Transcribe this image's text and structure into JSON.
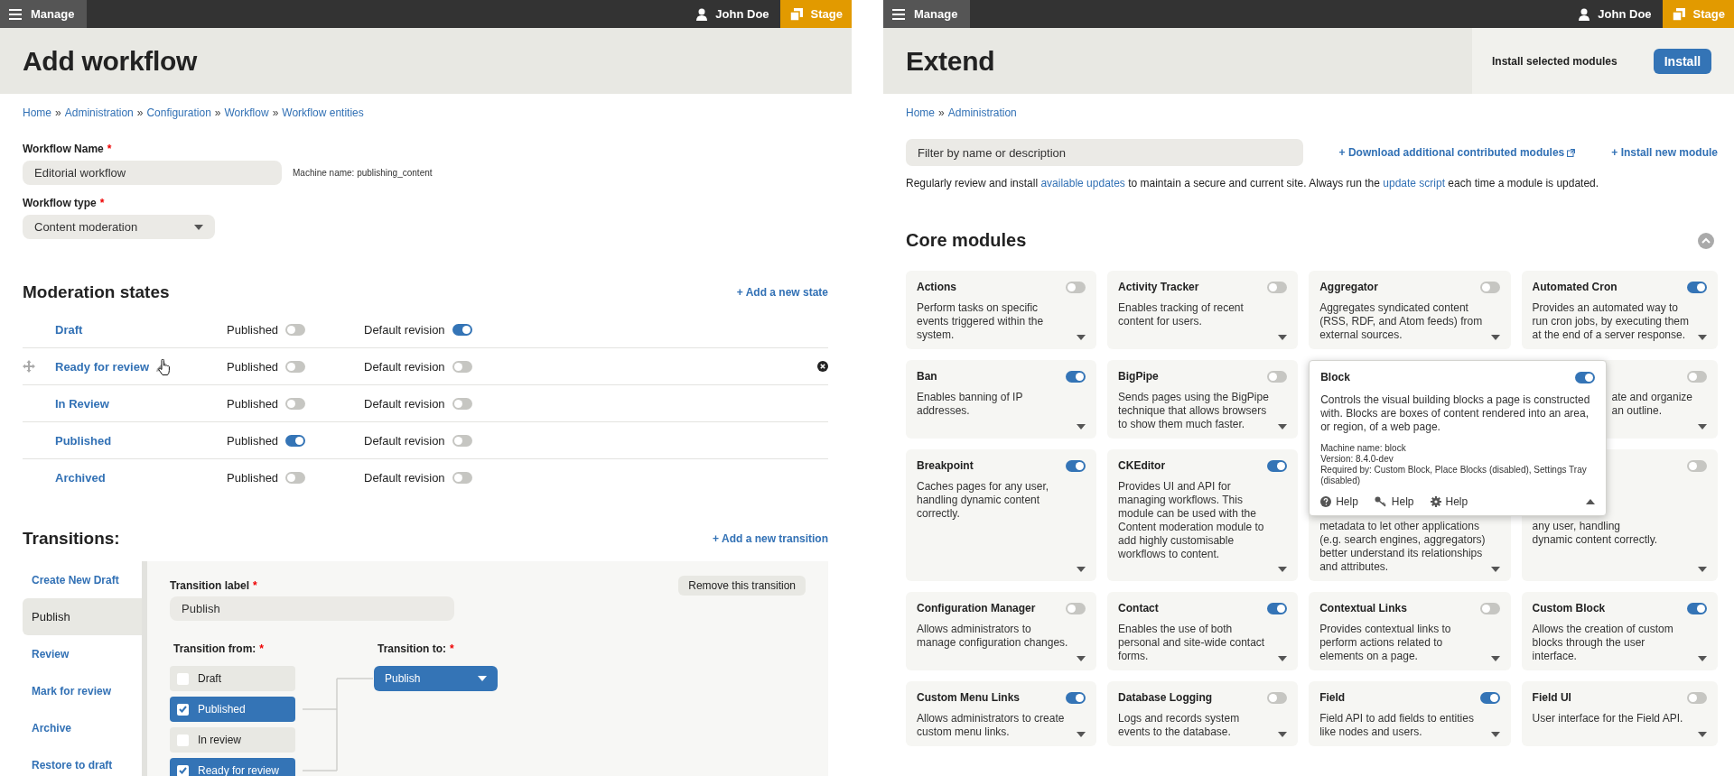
{
  "left": {
    "toolbar": {
      "menu": "Manage",
      "user": "John Doe",
      "stage": "Stage"
    },
    "title": "Add workflow",
    "breadcrumb": [
      "Home",
      "Administration",
      "Configuration",
      "Workflow",
      "Workflow entities"
    ],
    "breadcrumb_separator": "»",
    "workflow_name": {
      "label": "Workflow Name",
      "required_mark": "*",
      "value": "Editorial workflow",
      "machine_name": "Machine name: publishing_content"
    },
    "workflow_type": {
      "label": "Workflow type",
      "required_mark": "*",
      "value": "Content moderation"
    },
    "states": {
      "title": "Moderation states",
      "add_link": "+ Add a new state",
      "rows": [
        {
          "name": "Draft",
          "published_label": "Published",
          "published": false,
          "default_label": "Default revision",
          "default_revision": true,
          "hovered": false
        },
        {
          "name": "Ready for review",
          "published_label": "Published",
          "published": false,
          "default_label": "Default revision",
          "default_revision": false,
          "hovered": true
        },
        {
          "name": "In Review",
          "published_label": "Published",
          "published": false,
          "default_label": "Default revision",
          "default_revision": false,
          "hovered": false
        },
        {
          "name": "Published",
          "published_label": "Published",
          "published": true,
          "default_label": "Default revision",
          "default_revision": false,
          "hovered": false
        },
        {
          "name": "Archived",
          "published_label": "Published",
          "published": false,
          "default_label": "Default revision",
          "default_revision": false,
          "hovered": false
        }
      ]
    },
    "transitions": {
      "title": "Transitions:",
      "add_link": "+ Add a new transition",
      "tabs": [
        {
          "label": "Create New Draft",
          "selected": false
        },
        {
          "label": "Publish",
          "selected": true
        },
        {
          "label": "Review",
          "selected": false
        },
        {
          "label": "Mark for review",
          "selected": false
        },
        {
          "label": "Archive",
          "selected": false
        },
        {
          "label": "Restore to draft",
          "selected": false
        }
      ],
      "form": {
        "label_title": "Transition label",
        "required_mark": "*",
        "label_value": "Publish",
        "remove_button": "Remove this transition",
        "from_title": "Transition from:",
        "to_title": "Transition to:",
        "to_value": "Publish",
        "from_options": [
          {
            "label": "Draft",
            "checked": false
          },
          {
            "label": "Published",
            "checked": true
          },
          {
            "label": "In review",
            "checked": false
          },
          {
            "label": "Ready for review",
            "checked": true
          }
        ]
      }
    }
  },
  "right": {
    "toolbar": {
      "menu": "Manage",
      "user": "John Doe",
      "stage": "Stage"
    },
    "title": "Extend",
    "install_label": "Install selected modules",
    "install_button": "Install",
    "breadcrumb": [
      "Home",
      "Administration"
    ],
    "breadcrumb_separator": "»",
    "filter_placeholder": "Filter by name or description",
    "links": [
      {
        "label": "+ Download additional contributed modules",
        "external": true
      },
      {
        "label": "+ Install new module",
        "external": false
      }
    ],
    "notice": [
      {
        "text": "Regularly review and install "
      },
      {
        "text": "available updates",
        "kind": "link"
      },
      {
        "text": " to maintain a secure and current site. Always run the "
      },
      {
        "text": "update script",
        "kind": "link"
      },
      {
        "text": " each time a module is updated."
      }
    ],
    "modules": {
      "title": "Core modules",
      "cards": [
        {
          "kind": "card",
          "name": "Actions",
          "enabled": false,
          "description": "Perform tasks on specific events triggered within the system."
        },
        {
          "kind": "card",
          "name": "Activity Tracker",
          "enabled": false,
          "description": "Enables tracking of recent content for users."
        },
        {
          "kind": "card",
          "name": "Aggregator",
          "enabled": false,
          "description": "Aggregates syndicated content (RSS, RDF, and Atom feeds) from external sources."
        },
        {
          "kind": "card",
          "name": "Automated Cron",
          "enabled": true,
          "description": "Provides an automated way to run cron jobs, by executing them at the end of a server response."
        },
        {
          "kind": "card",
          "name": "Ban",
          "enabled": true,
          "description": "Enables banning of IP addresses."
        },
        {
          "kind": "card",
          "name": "BigPipe",
          "enabled": false,
          "description": "Sends pages using the BigPipe technique that allows browsers to show them much faster."
        },
        {
          "kind": "expanded",
          "name": "Block",
          "enabled": true,
          "description": "Controls the visual building blocks a page is constructed with. Blocks are boxes of content rendered into an area, or region, of a web page.",
          "details": [
            "Machine name: block",
            "Version: 8.4.0-dev",
            "Required by: Custom Block, Place Blocks (disabled), Settings Tray (disabled)"
          ],
          "help_links": [
            {
              "kind": "help",
              "label": "Help"
            },
            {
              "kind": "permissions",
              "label": "Help"
            },
            {
              "kind": "configure",
              "label": "Help"
            }
          ]
        },
        {
          "kind": "sidecut",
          "enabled": false,
          "lines": [
            "ate and organize",
            "an outline."
          ]
        },
        {
          "kind": "card",
          "name": "Breakpoint",
          "enabled": true,
          "description": "Caches pages for any user, handling dynamic content correctly."
        },
        {
          "kind": "card",
          "name": "CKEditor",
          "enabled": true,
          "description": "Provides UI and API for managing workflows. This module can be used with the Content moderation module to add highly customisable workflows to content."
        },
        {
          "kind": "topcut",
          "lines": [
            "metadata to let other applications",
            "(e.g. search engines, aggregators)",
            "better understand its relationships",
            "and attributes."
          ]
        },
        {
          "kind": "topcut",
          "enabled": false,
          "lines": [
            "any user, handling",
            "dynamic content correctly."
          ]
        },
        {
          "kind": "card",
          "name": "Configuration Manager",
          "enabled": false,
          "description": "Allows administrators to manage configuration changes."
        },
        {
          "kind": "card",
          "name": "Contact",
          "enabled": true,
          "description": "Enables the use of both personal and site-wide contact forms."
        },
        {
          "kind": "card",
          "name": "Contextual Links",
          "enabled": false,
          "description": "Provides contextual links to perform actions related to elements on a page."
        },
        {
          "kind": "card",
          "name": "Custom Block",
          "enabled": true,
          "description": "Allows the creation of custom blocks through the user interface."
        },
        {
          "kind": "card",
          "name": "Custom Menu Links",
          "enabled": true,
          "description": "Allows administrators to create custom menu links."
        },
        {
          "kind": "card",
          "name": "Database Logging",
          "enabled": false,
          "description": "Logs and records system events to the database."
        },
        {
          "kind": "card",
          "name": "Field",
          "enabled": true,
          "description": "Field API to add fields to entities like nodes and users."
        },
        {
          "kind": "card",
          "name": "Field UI",
          "enabled": false,
          "description": "User interface for the Field API."
        }
      ]
    }
  }
}
